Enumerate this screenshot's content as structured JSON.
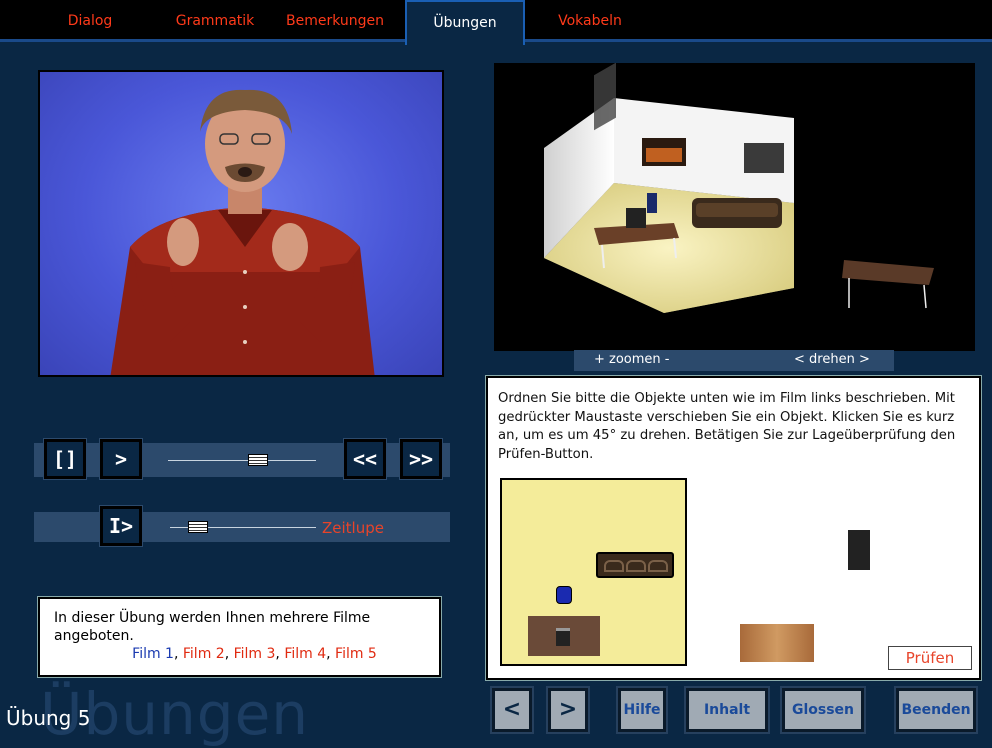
{
  "tabs": [
    {
      "label": "Dialog"
    },
    {
      "label": "Grammatik"
    },
    {
      "label": "Bemerkungen"
    },
    {
      "label": "Übungen"
    },
    {
      "label": "Vokabeln"
    }
  ],
  "video_controls": {
    "stop_label": "[]",
    "play_label": ">",
    "rewind_label": "<<",
    "forward_label": ">>",
    "slowplay_label": "I>",
    "zeitlupe_label": "Zeitlupe"
  },
  "info": {
    "text": "In dieser Übung werden Ihnen mehrere Filme angeboten.",
    "films": [
      "Film 1",
      "Film 2",
      "Film 3",
      "Film 4",
      "Film 5"
    ],
    "separator": ", "
  },
  "footer": {
    "watermark": "Übungen",
    "exercise_label": "Übung 5"
  },
  "room": {
    "zoom_label": "+ zoomen -",
    "rotate_label": "< drehen >"
  },
  "task": {
    "instructions": "Ordnen Sie bitte die Objekte unten wie im Film links beschrieben. Mit gedrückter Maustaste verschieben Sie ein Objekt. Klicken Sie es kurz an, um es um 45° zu drehen. Betätigen Sie zur Lageüberprüfung den Prüfen-Button.",
    "check_label": "Prüfen"
  },
  "bottom_buttons": {
    "prev_label": "<",
    "next_label": ">",
    "hilfe_label": "Hilfe",
    "inhalt_label": "Inhalt",
    "glossen_label": "Glossen",
    "beenden_label": "Beenden"
  },
  "colors": {
    "background": "#0a2744",
    "accent_red": "#e8442a",
    "film_blue": "#1a3ab0",
    "floor_yellow": "#f4ec9a"
  }
}
